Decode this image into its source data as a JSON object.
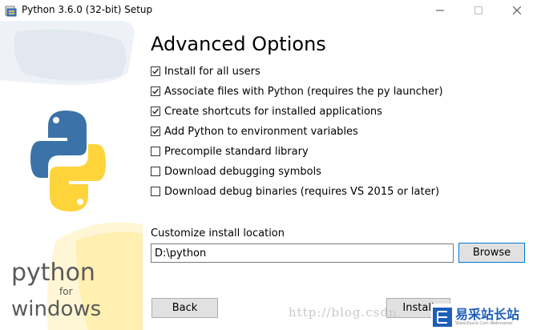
{
  "window": {
    "title": "Python 3.6.0 (32-bit) Setup"
  },
  "branding": {
    "word": "python",
    "for": "for",
    "platform": "windows"
  },
  "heading": "Advanced Options",
  "options": [
    {
      "label": "Install for all users",
      "checked": true
    },
    {
      "label": "Associate files with Python (requires the py launcher)",
      "checked": true
    },
    {
      "label": "Create shortcuts for installed applications",
      "checked": true
    },
    {
      "label": "Add Python to environment variables",
      "checked": true
    },
    {
      "label": "Precompile standard library",
      "checked": false
    },
    {
      "label": "Download debugging symbols",
      "checked": false
    },
    {
      "label": "Download debug binaries (requires VS 2015 or later)",
      "checked": false
    }
  ],
  "location": {
    "label": "Customize install location",
    "value": "D:\\python"
  },
  "buttons": {
    "browse": "Browse",
    "back": "Back",
    "install": "Install"
  },
  "watermark": "http://blog.csdn.",
  "logo": {
    "cn": "易采站长站",
    "en": "Www.Easck.Com Webmaster"
  },
  "colors": {
    "python_blue": "#3b73a8",
    "python_yellow": "#ffd43b",
    "accent": "#0078d7"
  }
}
